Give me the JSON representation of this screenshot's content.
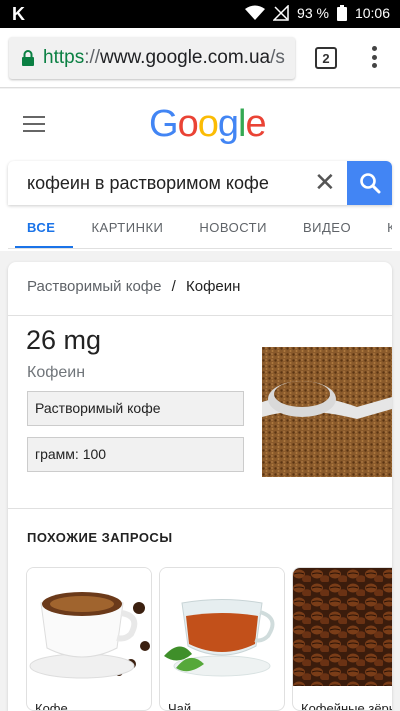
{
  "status_bar": {
    "app_letter": "K",
    "battery": "93 %",
    "time": "10:06"
  },
  "browser": {
    "url_scheme": "https",
    "url_separator": "://",
    "url_host": "www.google.com.ua",
    "url_tail": "/s",
    "tab_count": "2"
  },
  "header": {
    "logo_letters": [
      "G",
      "o",
      "o",
      "g",
      "l",
      "e"
    ],
    "logo_colors": [
      "#4285f4",
      "#ea4335",
      "#fbbc05",
      "#4285f4",
      "#34a853",
      "#ea4335"
    ]
  },
  "search": {
    "query": "кофеин в растворимом кофе",
    "accent": "#4285f4"
  },
  "tabs": [
    {
      "label": "ВСЕ",
      "active": true
    },
    {
      "label": "КАРТИНКИ",
      "active": false
    },
    {
      "label": "НОВОСТИ",
      "active": false
    },
    {
      "label": "ВИДЕО",
      "active": false
    },
    {
      "label": "КА",
      "active": false
    }
  ],
  "result": {
    "breadcrumb_parent": "Растворимый кофе",
    "breadcrumb_sep": "/",
    "breadcrumb_current": "Кофеин",
    "amount": "26 mg",
    "amount_label": "Кофеин",
    "food_select": "Растворимый кофе",
    "unit_select": "грамм: 100"
  },
  "related": {
    "title": "ПОХОЖИЕ ЗАПРОСЫ",
    "items": [
      {
        "label": "Кофе",
        "image": "coffee-cup-image"
      },
      {
        "label": "Чай",
        "image": "tea-cup-image"
      },
      {
        "label": "Кофейные зёрна",
        "image": "coffee-beans-image"
      }
    ]
  }
}
